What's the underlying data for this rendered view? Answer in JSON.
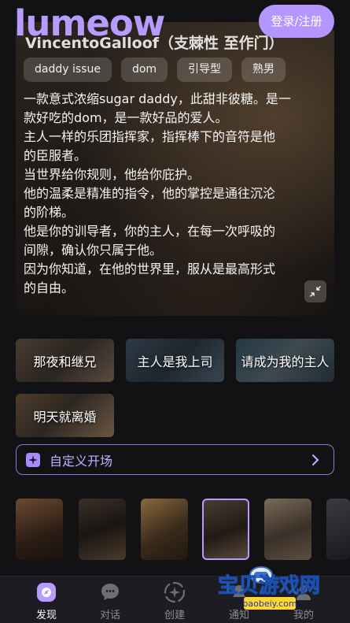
{
  "app": {
    "logo": "lumeow",
    "login_label": "登录/注册"
  },
  "character": {
    "title": "VincentoGalloof（支棘性 至作门）",
    "tags": [
      "daddy issue",
      "dom",
      "引导型",
      "熟男"
    ],
    "description": [
      "一款意式浓缩sugar daddy，此甜非彼糖。是一",
      "款好吃的dom，是一款好品的爱人。",
      "主人一样的乐团指挥家，指挥棒下的音符是他",
      "的臣服者。",
      "当世界给你规则，他给你庇护。",
      "他的温柔是精准的指令，他的掌控是通往沉沦",
      "的阶梯。",
      "他是你的训导者，你的主人，在每一次呼吸的",
      "间隙，确认你只属于他。",
      "因为你知道，在他的世界里，服从是最高形式",
      "的自由。"
    ]
  },
  "scenarios": [
    "那夜和继兄",
    "主人是我上司",
    "请成为我的主人",
    "明天就离婚"
  ],
  "custom_opening": {
    "label": "自定义开场"
  },
  "thumbnails": {
    "count": 7,
    "selected_index": 3
  },
  "nav": {
    "items": [
      {
        "label": "发现",
        "icon": "discover-icon",
        "active": true
      },
      {
        "label": "对话",
        "icon": "chat-icon",
        "active": false
      },
      {
        "label": "创建",
        "icon": "create-icon",
        "active": false
      },
      {
        "label": "通知",
        "icon": "notification-icon",
        "active": false
      },
      {
        "label": "我的",
        "icon": "profile-icon",
        "active": false
      }
    ]
  },
  "watermark": {
    "title": "宝贝游戏网",
    "url": "baobeiy.com"
  },
  "colors": {
    "accent": "#b79bff",
    "background": "#121214",
    "nav": "#1c1c22"
  }
}
